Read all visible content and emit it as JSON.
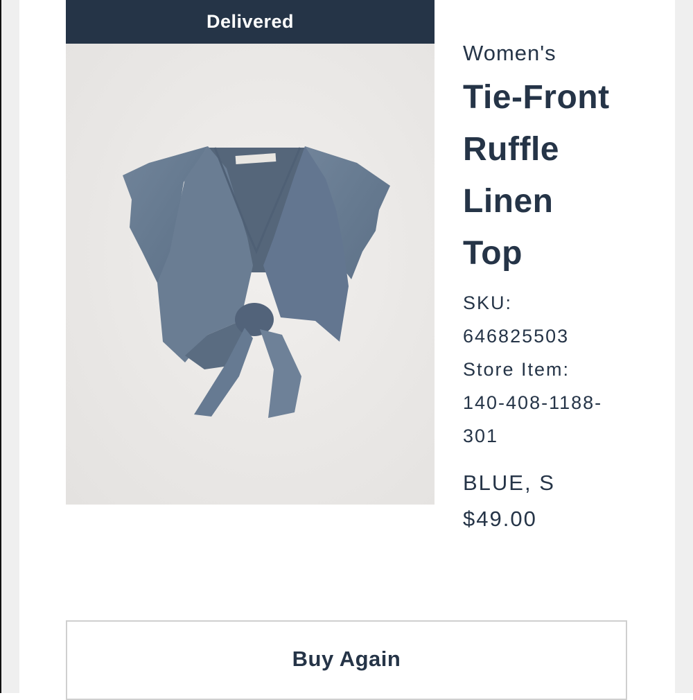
{
  "order_item": {
    "status_label": "Delivered",
    "image_icon": "product-photo-blue-linen-top",
    "gender": "Women's",
    "title_lines": [
      "Tie-Front",
      "Ruffle",
      "Linen",
      "Top"
    ],
    "sku_label": "SKU:",
    "sku_value": "646825503",
    "store_item_label": "Store Item:",
    "store_item_value_lines": [
      "140-408-1188-",
      "301"
    ],
    "variant": "BLUE, S",
    "price": "$49.00"
  },
  "actions": {
    "buy_again_label": "Buy Again"
  },
  "colors": {
    "banner": "#253447",
    "text": "#253447",
    "garment": "#6b7d92"
  }
}
